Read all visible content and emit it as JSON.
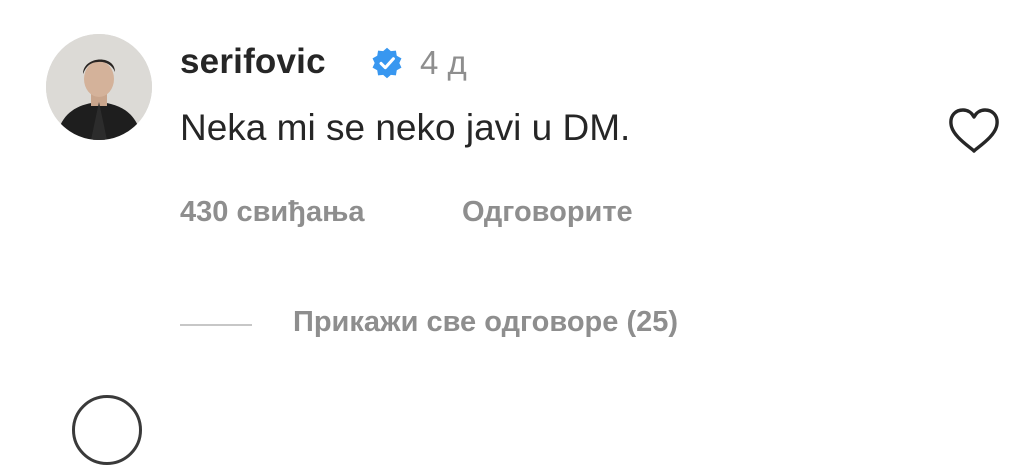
{
  "comment": {
    "username": "serifovic",
    "verified_icon": "verified-badge-icon",
    "age": "4 д",
    "text": "Neka mi se neko javi u DM.",
    "likes": "430 свиђања",
    "reply_label": "Одговорите",
    "view_replies_label": "Прикажи све одговоре (25)",
    "like_icon": "heart-outline-icon"
  },
  "colors": {
    "text": "#262626",
    "secondary": "#8e8e8e",
    "verified": "#3897f0",
    "divider": "#c7c7c7"
  }
}
